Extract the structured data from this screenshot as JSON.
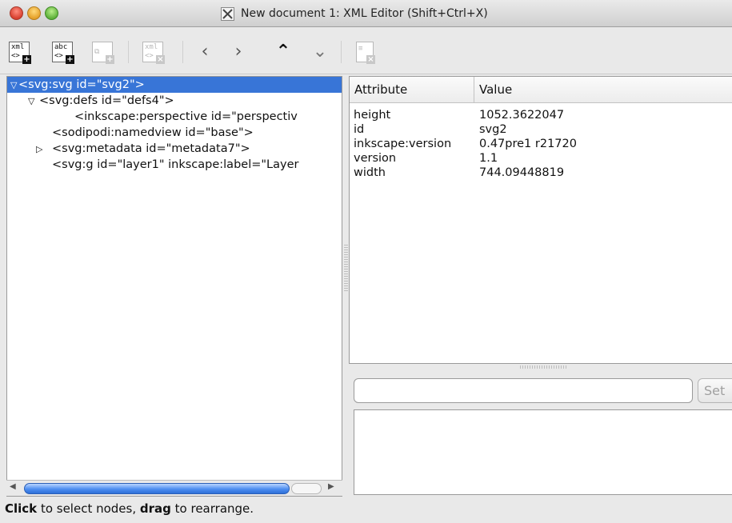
{
  "window": {
    "title": "New document 1: XML Editor (Shift+Ctrl+X)"
  },
  "toolbar": {
    "buttons": [
      {
        "name": "new-element-node",
        "icon": "xml-new-node-icon",
        "line1": "xml",
        "line2": "<>"
      },
      {
        "name": "new-text-node",
        "icon": "text-new-node-icon",
        "line1": "abc",
        "line2": "<>"
      },
      {
        "name": "duplicate-node",
        "icon": "duplicate-node-icon"
      },
      {
        "name": "delete-node",
        "icon": "delete-node-icon",
        "line1": "xml",
        "line2": "<>"
      },
      {
        "name": "unindent-node",
        "glyph": "‹"
      },
      {
        "name": "indent-node",
        "glyph": "›"
      },
      {
        "name": "raise-node",
        "glyph": "⌃"
      },
      {
        "name": "lower-node",
        "glyph": "⌄"
      },
      {
        "name": "delete-attribute",
        "icon": "delete-attribute-icon"
      }
    ]
  },
  "tree": {
    "nodes": [
      {
        "text": "<svg:svg id=\"svg2\">",
        "arrow": "▽",
        "selected": true
      },
      {
        "text": "<svg:defs id=\"defs4\">",
        "arrow": "▽"
      },
      {
        "text": "<inkscape:perspective id=\"perspectiv",
        "arrow": ""
      },
      {
        "text": "<sodipodi:namedview id=\"base\">",
        "arrow": ""
      },
      {
        "text": "<svg:metadata id=\"metadata7\">",
        "arrow": "▷"
      },
      {
        "text": "<svg:g id=\"layer1\" inkscape:label=\"Layer",
        "arrow": ""
      }
    ]
  },
  "attributes": {
    "header_attribute": "Attribute",
    "header_value": "Value",
    "rows": [
      {
        "key": "height",
        "value": "1052.3622047"
      },
      {
        "key": "id",
        "value": "svg2"
      },
      {
        "key": "inkscape:version",
        "value": "0.47pre1 r21720"
      },
      {
        "key": "version",
        "value": "1.1"
      },
      {
        "key": "width",
        "value": "744.09448819"
      }
    ]
  },
  "value_editor": {
    "input_value": "",
    "set_label": "Set"
  },
  "status": {
    "click_word": "Click",
    "mid_text": " to select nodes, ",
    "drag_word": "drag",
    "end_text": " to rearrange."
  }
}
